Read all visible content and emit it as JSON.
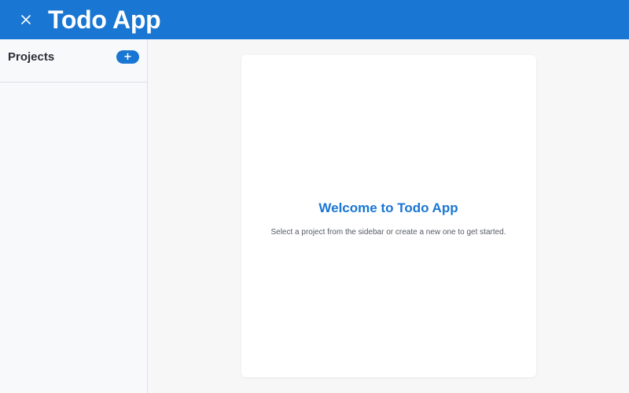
{
  "app": {
    "title": "Todo App",
    "accent_color": "#1976d2",
    "close_icon": "close-icon"
  },
  "sidebar": {
    "title": "Projects",
    "add_button_label": "+",
    "projects": []
  },
  "main": {
    "welcome_title": "Welcome to Todo App",
    "welcome_text": "Select a project from the sidebar or create a new one to get started."
  }
}
